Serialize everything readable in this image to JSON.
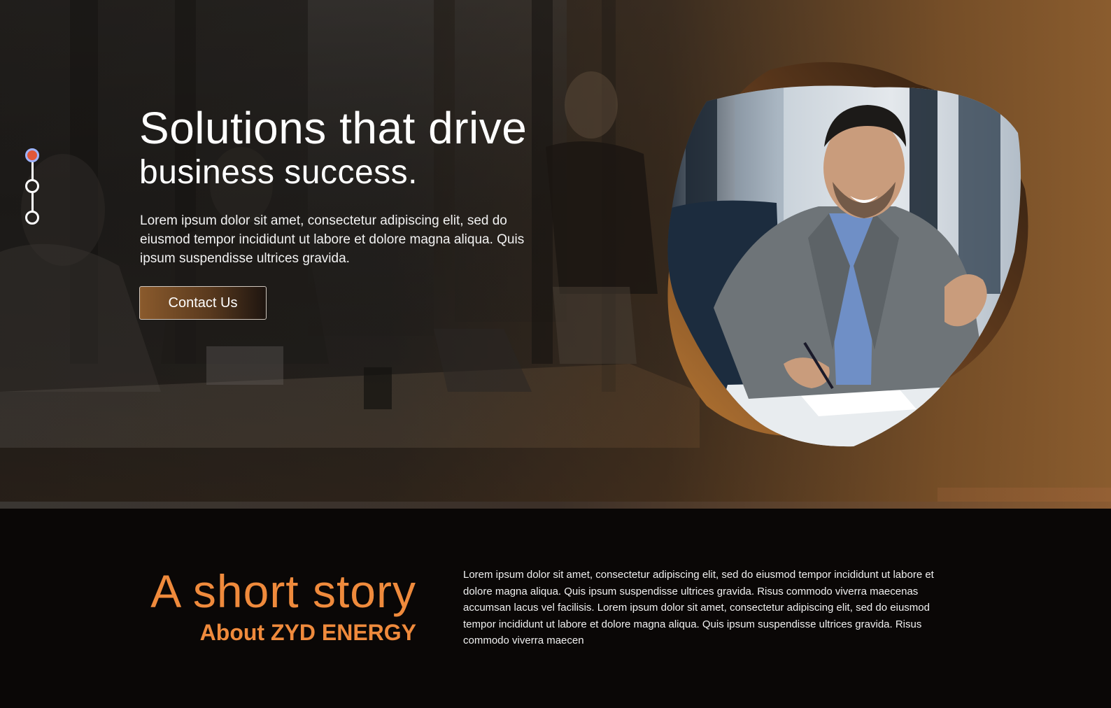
{
  "hero": {
    "title": "Solutions that drive",
    "subtitle": "business success.",
    "description": "Lorem ipsum dolor sit amet, consectetur adipiscing elit, sed do eiusmod tempor incididunt ut labore et dolore magna aliqua. Quis ipsum suspendisse ultrices gravida.",
    "cta_label": "Contact Us",
    "slides": {
      "count": 3,
      "active": 1
    },
    "accent_color": "#8a5a2c"
  },
  "story": {
    "title": "A short story",
    "subtitle": "About ZYD ENERGY",
    "body": "Lorem ipsum dolor sit amet, consectetur adipiscing elit, sed do eiusmod tempor incididunt ut labore et dolore magna aliqua. Quis ipsum suspendisse ultrices gravida. Risus commodo viverra maecenas accumsan lacus vel facilisis. Lorem ipsum dolor sit amet, consectetur adipiscing elit, sed do eiusmod tempor incididunt ut labore et dolore magna aliqua. Quis ipsum suspendisse ultrices gravida. Risus commodo viverra maecen",
    "accent_color": "#ef8a3c"
  }
}
